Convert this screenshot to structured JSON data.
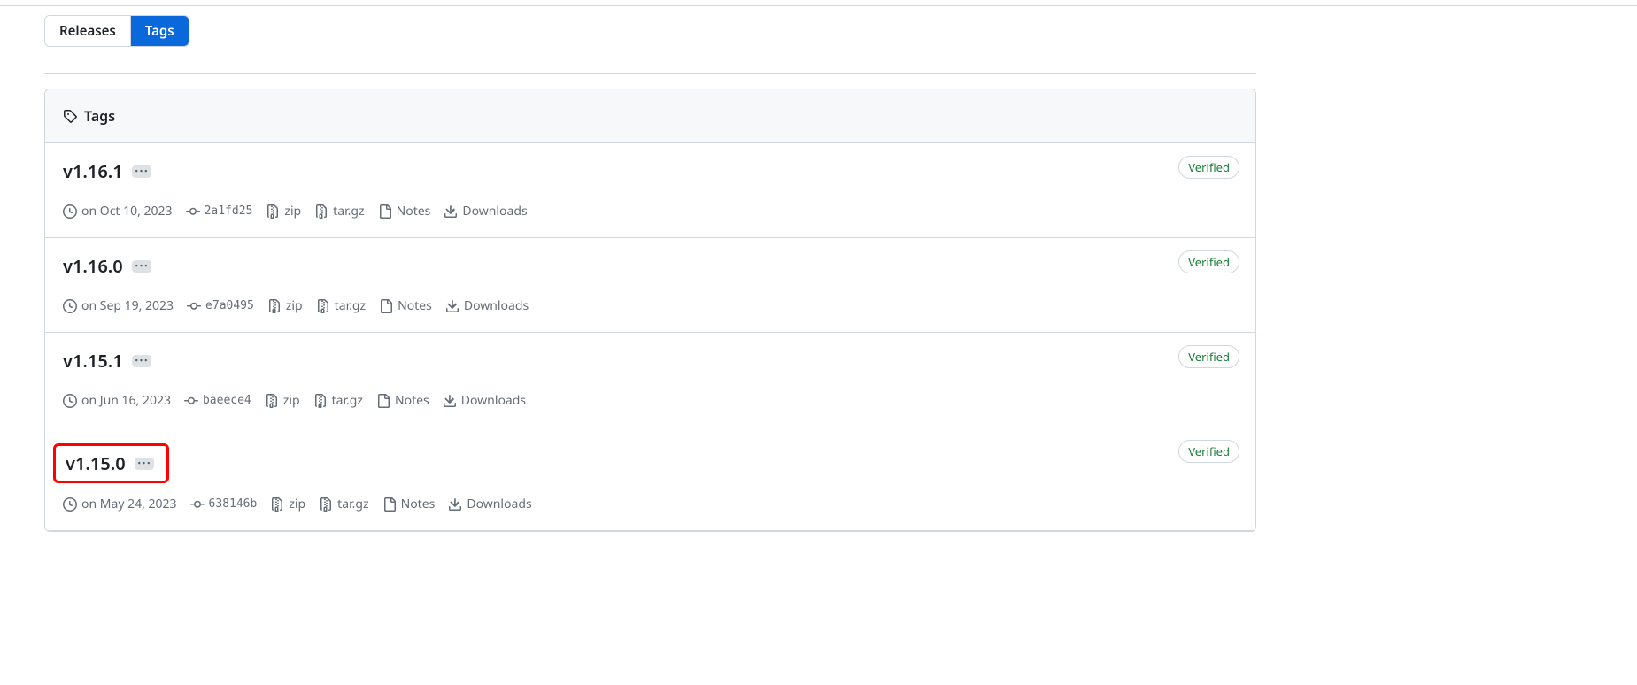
{
  "tabs": {
    "releases": "Releases",
    "tags": "Tags"
  },
  "panelHeader": "Tags",
  "labels": {
    "zip": "zip",
    "targz": "tar.gz",
    "notes": "Notes",
    "downloads": "Downloads",
    "verified": "Verified"
  },
  "tags": [
    {
      "name": "v1.16.1",
      "date": "on Oct 10, 2023",
      "commit": "2a1fd25",
      "highlight": false
    },
    {
      "name": "v1.16.0",
      "date": "on Sep 19, 2023",
      "commit": "e7a0495",
      "highlight": false
    },
    {
      "name": "v1.15.1",
      "date": "on Jun 16, 2023",
      "commit": "baeece4",
      "highlight": false
    },
    {
      "name": "v1.15.0",
      "date": "on May 24, 2023",
      "commit": "638146b",
      "highlight": true
    }
  ]
}
